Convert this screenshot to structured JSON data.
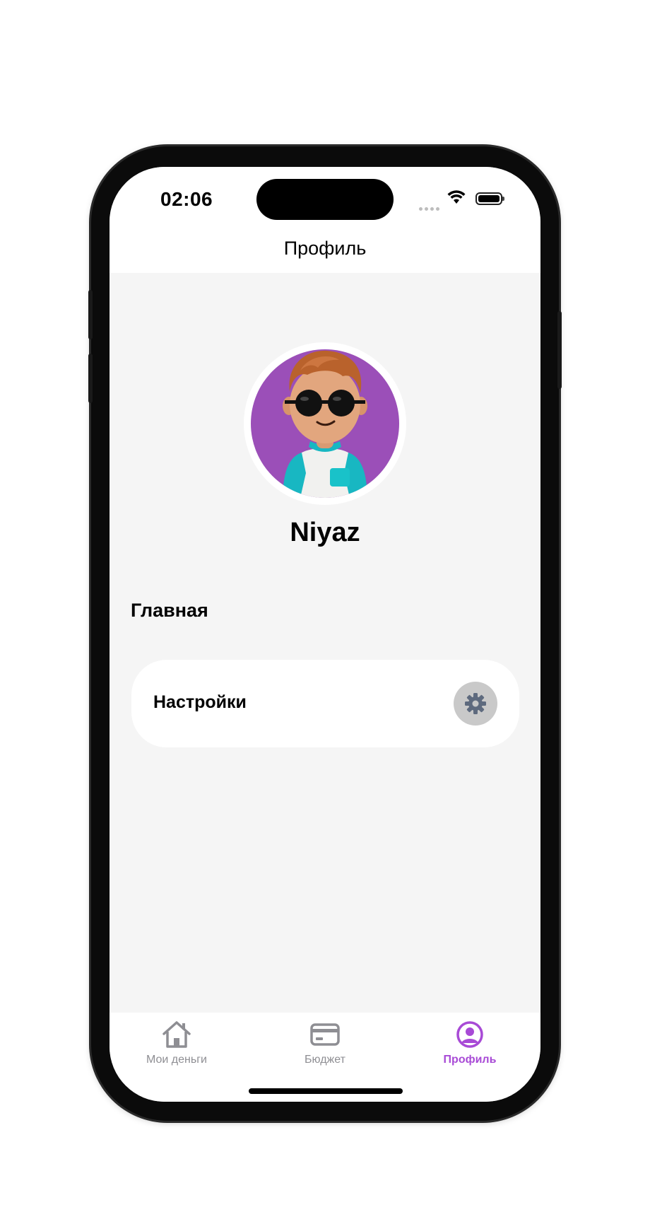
{
  "status_bar": {
    "time": "02:06",
    "wifi_icon": "wifi-icon",
    "battery_icon": "battery-icon"
  },
  "header": {
    "title": "Профиль"
  },
  "profile": {
    "name": "Niyaz",
    "avatar_background": "#9b4fb8"
  },
  "main": {
    "section_title": "Главная",
    "settings_item": {
      "label": "Настройки",
      "icon": "gear-icon"
    }
  },
  "tab_bar": {
    "active_color": "#a84ad6",
    "inactive_color": "#8e8e93",
    "tabs": [
      {
        "label": "Мои деньги",
        "icon": "home-icon",
        "active": false
      },
      {
        "label": "Бюджет",
        "icon": "card-icon",
        "active": false
      },
      {
        "label": "Профиль",
        "icon": "profile-icon",
        "active": true
      }
    ]
  }
}
